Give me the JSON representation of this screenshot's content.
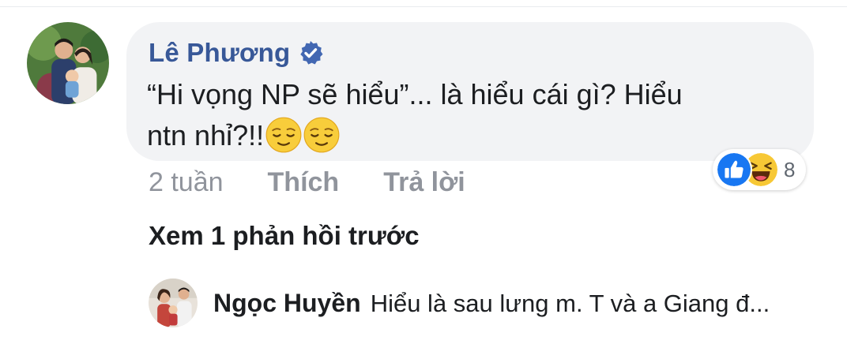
{
  "comment": {
    "author": "Lê Phương",
    "verified": true,
    "text_line1": "“Hi vọng NP sẽ hiểu”... là hiểu cái gì? Hiểu",
    "text_line2": "ntn nhỉ?!!",
    "emojis": [
      "relieved-face",
      "relieved-face"
    ],
    "time": "2 tuần",
    "like_label": "Thích",
    "reply_label": "Trả lời",
    "reactions": {
      "icons": [
        "like",
        "haha"
      ],
      "count": "8"
    }
  },
  "view_previous_replies": "Xem 1 phản hồi trước",
  "reply": {
    "author": "Ngọc Huyền",
    "text": "Hiểu là sau lưng m. T và a Giang đ..."
  },
  "colors": {
    "author_link": "#385898",
    "bubble_bg": "#f2f3f5",
    "meta_gray": "#90949c",
    "like_blue": "#1877f2",
    "haha_yellow": "#f7c835"
  }
}
